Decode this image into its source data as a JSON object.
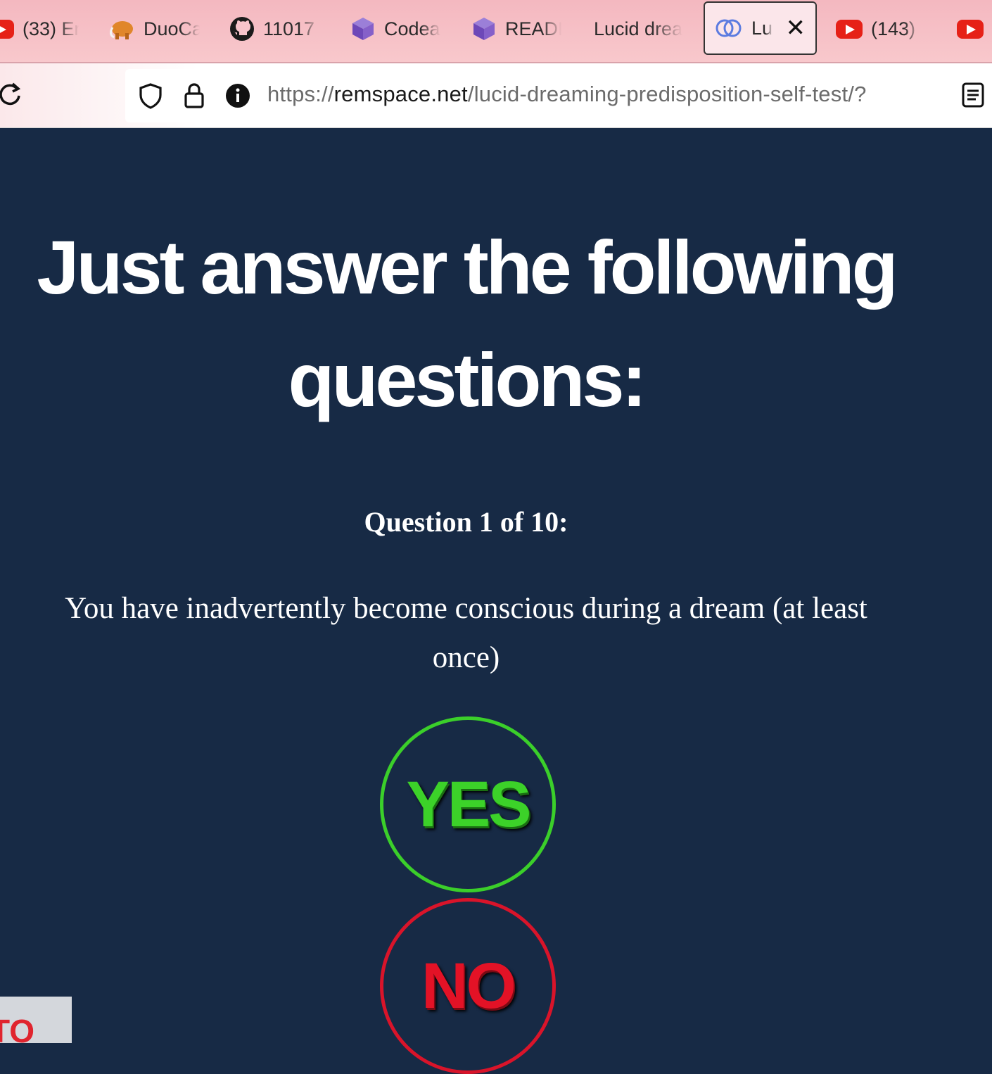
{
  "browser": {
    "tabs": [
      {
        "label": "(33) Er",
        "icon": "youtube-icon"
      },
      {
        "label": "DuoCa",
        "icon": "mammoth-icon"
      },
      {
        "label": "11017",
        "icon": "github-icon"
      },
      {
        "label": "Codea",
        "icon": "cube-icon"
      },
      {
        "label": "READI",
        "icon": "cube-icon"
      },
      {
        "label": "Lucid drea",
        "icon": ""
      },
      {
        "label": "Luc",
        "icon": "overlap-circles-icon",
        "active": true
      },
      {
        "label": "(143)",
        "icon": "youtube-icon"
      },
      {
        "label": "",
        "icon": "youtube-icon"
      }
    ],
    "url_scheme": "https://",
    "url_host": "remspace.net",
    "url_path": "/lucid-dreaming-predisposition-self-test/?"
  },
  "page": {
    "headline_line1": "Just answer the following",
    "headline_line2": "questions:",
    "question_counter": "Question 1 of 10:",
    "question_text": "You have inadvertently become conscious during a dream (at least once)",
    "yes_label": "YES",
    "no_label": "NO",
    "corner_button_text": "TO"
  },
  "colors": {
    "page_background": "#172a45",
    "yes_green": "#3cd229",
    "no_red": "#e31226",
    "tabbar_pink": "#f4b8c0"
  }
}
